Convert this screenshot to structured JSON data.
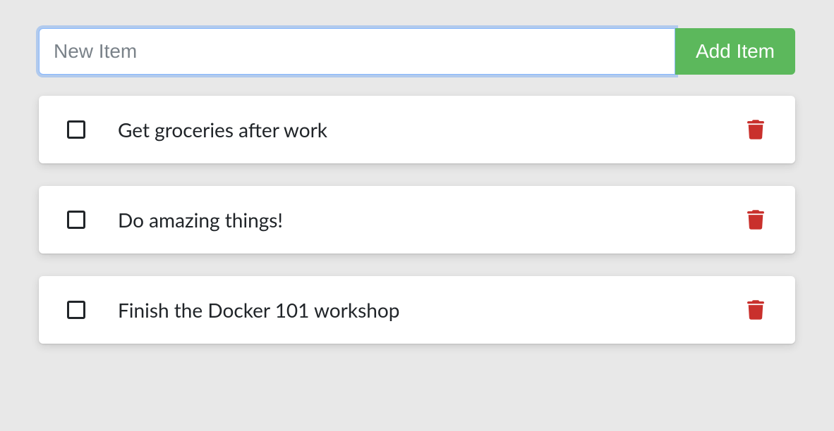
{
  "input": {
    "placeholder": "New Item",
    "value": ""
  },
  "add_button": {
    "label": "Add Item"
  },
  "items": [
    {
      "text": "Get groceries after work",
      "checked": false
    },
    {
      "text": "Do amazing things!",
      "checked": false
    },
    {
      "text": "Finish the Docker 101 workshop",
      "checked": false
    }
  ],
  "colors": {
    "add_button_bg": "#5cb85c",
    "delete_icon": "#c9302c",
    "focus_ring": "rgba(13,110,253,0.25)"
  }
}
